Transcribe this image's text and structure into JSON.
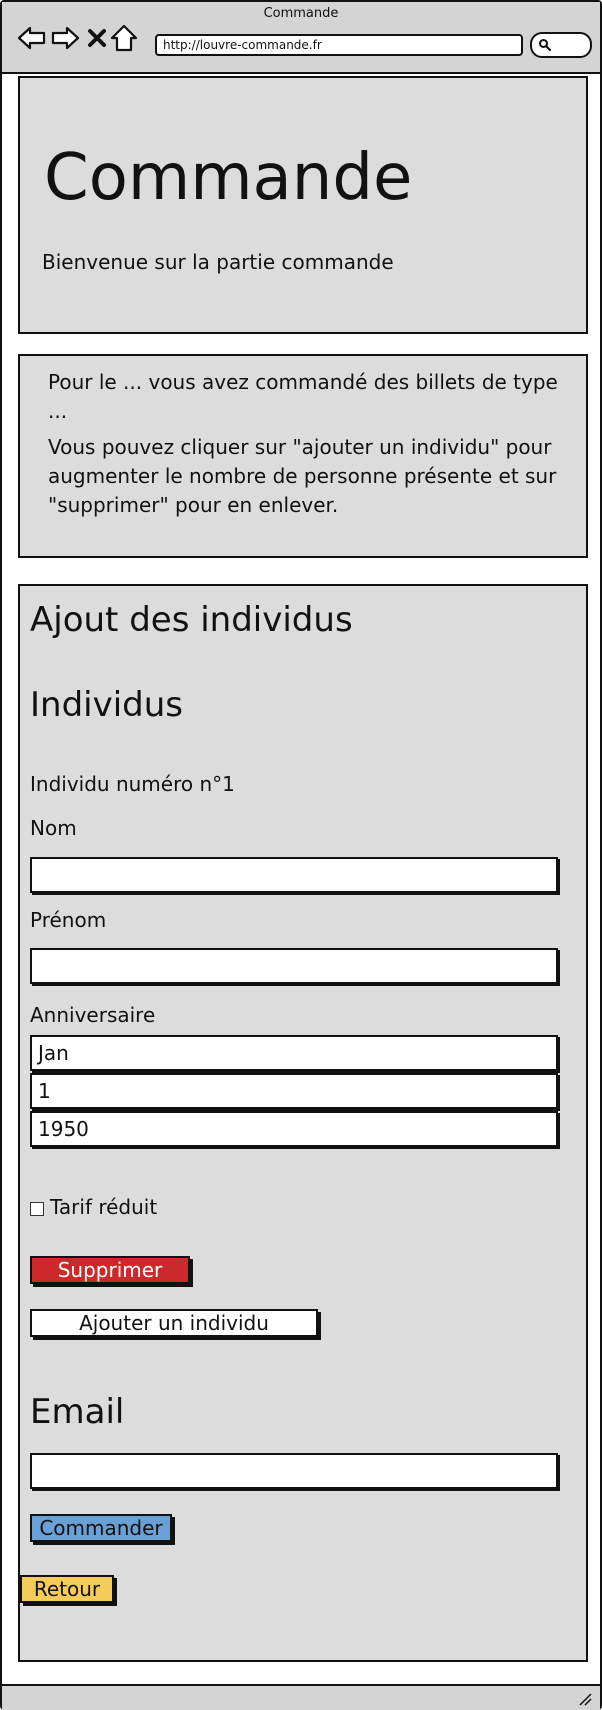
{
  "window": {
    "title": "Commande"
  },
  "browser": {
    "url": "http://louvre-commande.fr"
  },
  "header": {
    "title": "Commande",
    "welcome": "Bienvenue sur la partie commande"
  },
  "info": {
    "line1": "Pour le ... vous avez commandé des billets de type ...",
    "line2": "Vous pouvez cliquer sur \"ajouter un individu\" pour augmenter le nombre de personne présente et sur \"supprimer\" pour en enlever."
  },
  "form": {
    "section_title": "Ajout des individus",
    "individus_title": "Individus",
    "individu_label": "Individu numéro n°1",
    "nom_label": "Nom",
    "nom_value": "",
    "prenom_label": "Prénom",
    "prenom_value": "",
    "birthday_label": "Anniversaire",
    "birthday_month": "Jan",
    "birthday_day": "1",
    "birthday_year": "1950",
    "tarif_label": "Tarif réduit",
    "tarif_checked": false,
    "supprimer_label": "Supprimer",
    "ajouter_label": "Ajouter un individu",
    "email_title": "Email",
    "email_value": "",
    "commander_label": "Commander",
    "retour_label": "Retour"
  },
  "colors": {
    "supprimer": "#cc2a2a",
    "commander": "#6aa0d8",
    "retour": "#f5cc5a",
    "panel": "#dcdcdc"
  }
}
